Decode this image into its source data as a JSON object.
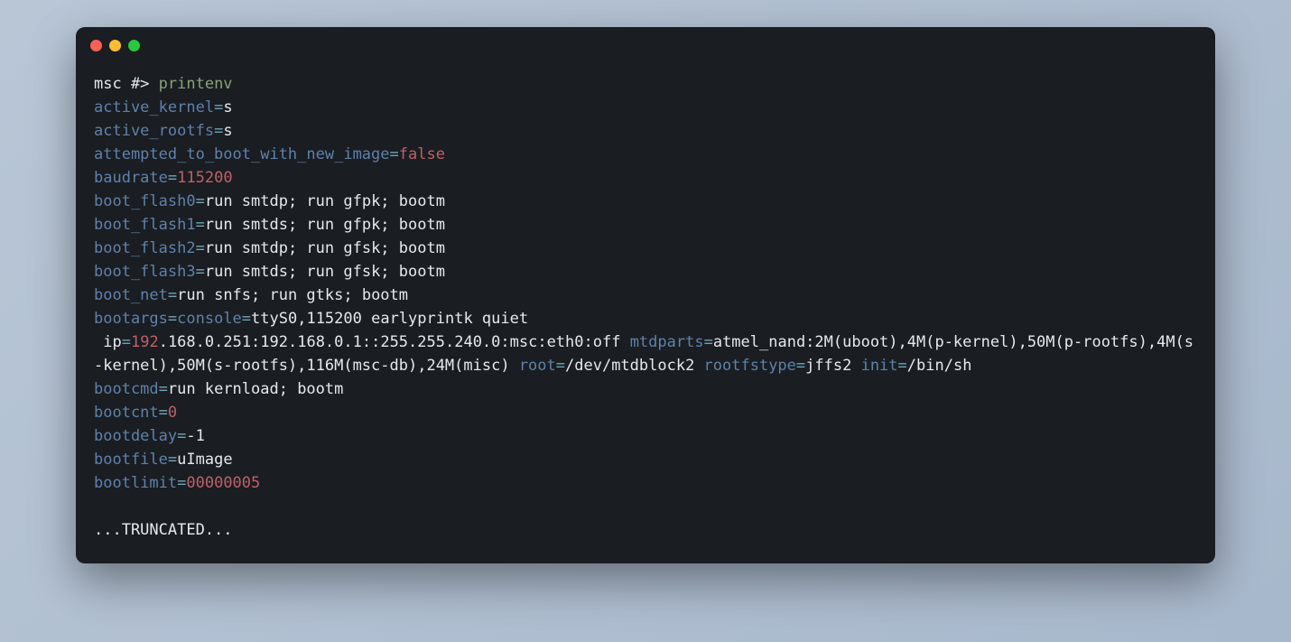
{
  "prompt": {
    "prefix": "msc #> ",
    "command": "printenv"
  },
  "env": {
    "active_kernel": {
      "key": "active_kernel",
      "val": "s"
    },
    "active_rootfs": {
      "key": "active_rootfs",
      "val": "s"
    },
    "attempted": {
      "key": "attempted_to_boot_with_new_image",
      "val": "false"
    },
    "baudrate": {
      "key": "baudrate",
      "val": "115200"
    },
    "boot_flash0": {
      "key": "boot_flash0",
      "val": "run smtdp; run gfpk; bootm"
    },
    "boot_flash1": {
      "key": "boot_flash1",
      "val": "run smtds; run gfpk; bootm"
    },
    "boot_flash2": {
      "key": "boot_flash2",
      "val": "run smtdp; run gfsk; bootm"
    },
    "boot_flash3": {
      "key": "boot_flash3",
      "val": "run smtds; run gfsk; bootm"
    },
    "boot_net": {
      "key": "boot_net",
      "val": "run snfs; run gtks; bootm"
    },
    "bootargs": {
      "key": "bootargs",
      "console_key": "console",
      "console_val": "ttyS0,115200 earlyprintk quiet",
      "ip_label": " ip",
      "ip_first": "192",
      "ip_rest": ".168.0.251:192.168.0.1::255.255.240.0:msc:eth0:off ",
      "mtdparts_key": "mtdparts",
      "mtdparts_val": "atmel_nand:2M(uboot),4M(p-kernel),50M(p-rootfs),4M(s-kernel),50M(s-rootfs),116M(msc-db),24M(misc) ",
      "root_key": "root",
      "root_val": "/dev/mtdblock2 ",
      "rootfstype_key": "rootfstype",
      "rootfstype_val": "jffs2 ",
      "init_key": "init",
      "init_val": "/bin/sh"
    },
    "bootcmd": {
      "key": "bootcmd",
      "val": "run kernload; bootm"
    },
    "bootcnt": {
      "key": "bootcnt",
      "val": "0"
    },
    "bootdelay": {
      "key": "bootdelay",
      "val": "-1"
    },
    "bootfile": {
      "key": "bootfile",
      "val": "uImage"
    },
    "bootlimit": {
      "key": "bootlimit",
      "val": "00000005"
    }
  },
  "truncated": "...TRUNCATED..."
}
